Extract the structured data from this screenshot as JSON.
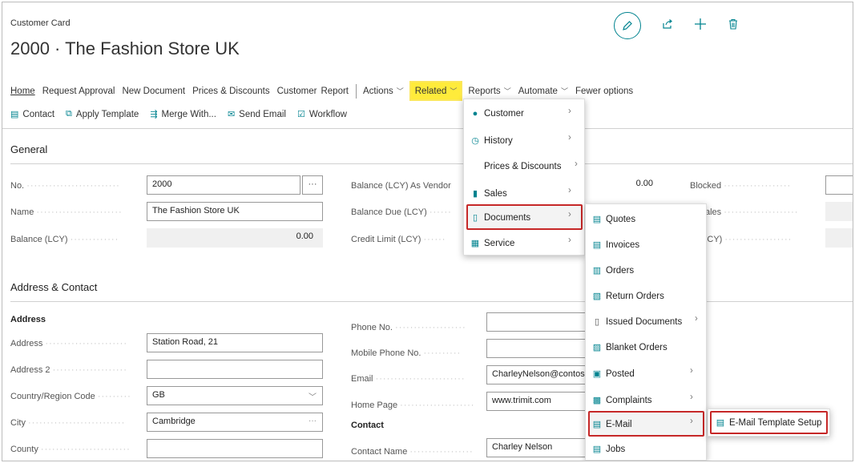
{
  "page": {
    "type_label": "Customer Card",
    "title": "2000 · The Fashion Store UK"
  },
  "top_icons": [
    "edit-icon",
    "share-icon",
    "plus-icon",
    "trash-icon"
  ],
  "action_bar": {
    "items": [
      {
        "label": "Home",
        "active": true
      },
      {
        "label": "Request Approval"
      },
      {
        "label": "New Document"
      },
      {
        "label": "Prices & Discounts"
      },
      {
        "label": "Customer"
      },
      {
        "label": "Report"
      }
    ],
    "actions": "Actions",
    "related": "Related",
    "reports": "Reports",
    "automate": "Automate",
    "fewer": "Fewer options"
  },
  "promoted": [
    {
      "label": "Contact",
      "icon": "contact-icon"
    },
    {
      "label": "Apply Template",
      "icon": "template-icon"
    },
    {
      "label": "Merge With...",
      "icon": "merge-icon"
    },
    {
      "label": "Send Email",
      "icon": "email-icon"
    },
    {
      "label": "Workflow",
      "icon": "workflow-icon"
    }
  ],
  "general": {
    "title": "General",
    "no_label": "No.",
    "no_value": "2000",
    "no_btn": "···",
    "name_label": "Name",
    "name_value": "The Fashion Store UK",
    "balance_label": "Balance (LCY)",
    "balance_value": "0.00",
    "balance_vendor_label": "Balance (LCY) As Vendor",
    "balance_vendor_value": "0.00",
    "balance_due_label": "Balance Due (LCY)",
    "credit_limit_label": "Credit Limit (LCY)",
    "blocked_label": "Blocked",
    "total_sales_label": "al Sales",
    "costs_label": "ts (LCY)"
  },
  "address": {
    "title": "Address & Contact",
    "address_heading": "Address",
    "address_label": "Address",
    "address_value": "Station Road, 21",
    "address2_label": "Address 2",
    "address2_value": "",
    "country_label": "Country/Region Code",
    "country_value": "GB",
    "city_label": "City",
    "city_value": "Cambridge",
    "city_btn": "···",
    "county_label": "County",
    "county_value": "",
    "phone_label": "Phone No.",
    "mobile_label": "Mobile Phone No.",
    "email_label": "Email",
    "email_value": "CharleyNelson@contos",
    "homepage_label": "Home Page",
    "homepage_value": "www.trimit.com",
    "contact_heading": "Contact",
    "contact_name_label": "Contact Name",
    "contact_name_value": "Charley Nelson"
  },
  "related_menu": [
    {
      "label": "Customer",
      "icon": "person-icon",
      "submenu": true
    },
    {
      "label": "History",
      "icon": "history-icon",
      "submenu": true
    },
    {
      "label": "Prices & Discounts",
      "icon": "",
      "submenu": true
    },
    {
      "label": "Sales",
      "icon": "sales-icon",
      "submenu": true
    },
    {
      "label": "Documents",
      "icon": "document-icon",
      "submenu": true,
      "highlighted": true
    },
    {
      "label": "Service",
      "icon": "service-icon",
      "submenu": true
    }
  ],
  "documents_menu": [
    {
      "label": "Quotes",
      "icon": "quotes-icon",
      "submenu": false
    },
    {
      "label": "Invoices",
      "icon": "invoices-icon",
      "submenu": false
    },
    {
      "label": "Orders",
      "icon": "orders-icon",
      "submenu": false
    },
    {
      "label": "Return Orders",
      "icon": "return-icon",
      "submenu": false
    },
    {
      "label": "Issued Documents",
      "icon": "issued-icon",
      "submenu": true
    },
    {
      "label": "Blanket Orders",
      "icon": "blanket-icon",
      "submenu": false
    },
    {
      "label": "Posted",
      "icon": "posted-icon",
      "submenu": true
    },
    {
      "label": "Complaints",
      "icon": "complaints-icon",
      "submenu": true
    },
    {
      "label": "E-Mail",
      "icon": "email-icon",
      "submenu": true,
      "highlighted": true
    },
    {
      "label": "Jobs",
      "icon": "jobs-icon",
      "submenu": false
    }
  ],
  "email_menu": [
    {
      "label": "E-Mail Template Setup",
      "icon": "email-template-icon",
      "highlighted": true
    }
  ],
  "colors": {
    "accent": "#00838f",
    "highlight_yellow": "#ffeb3b",
    "callout_red": "#c62828"
  }
}
